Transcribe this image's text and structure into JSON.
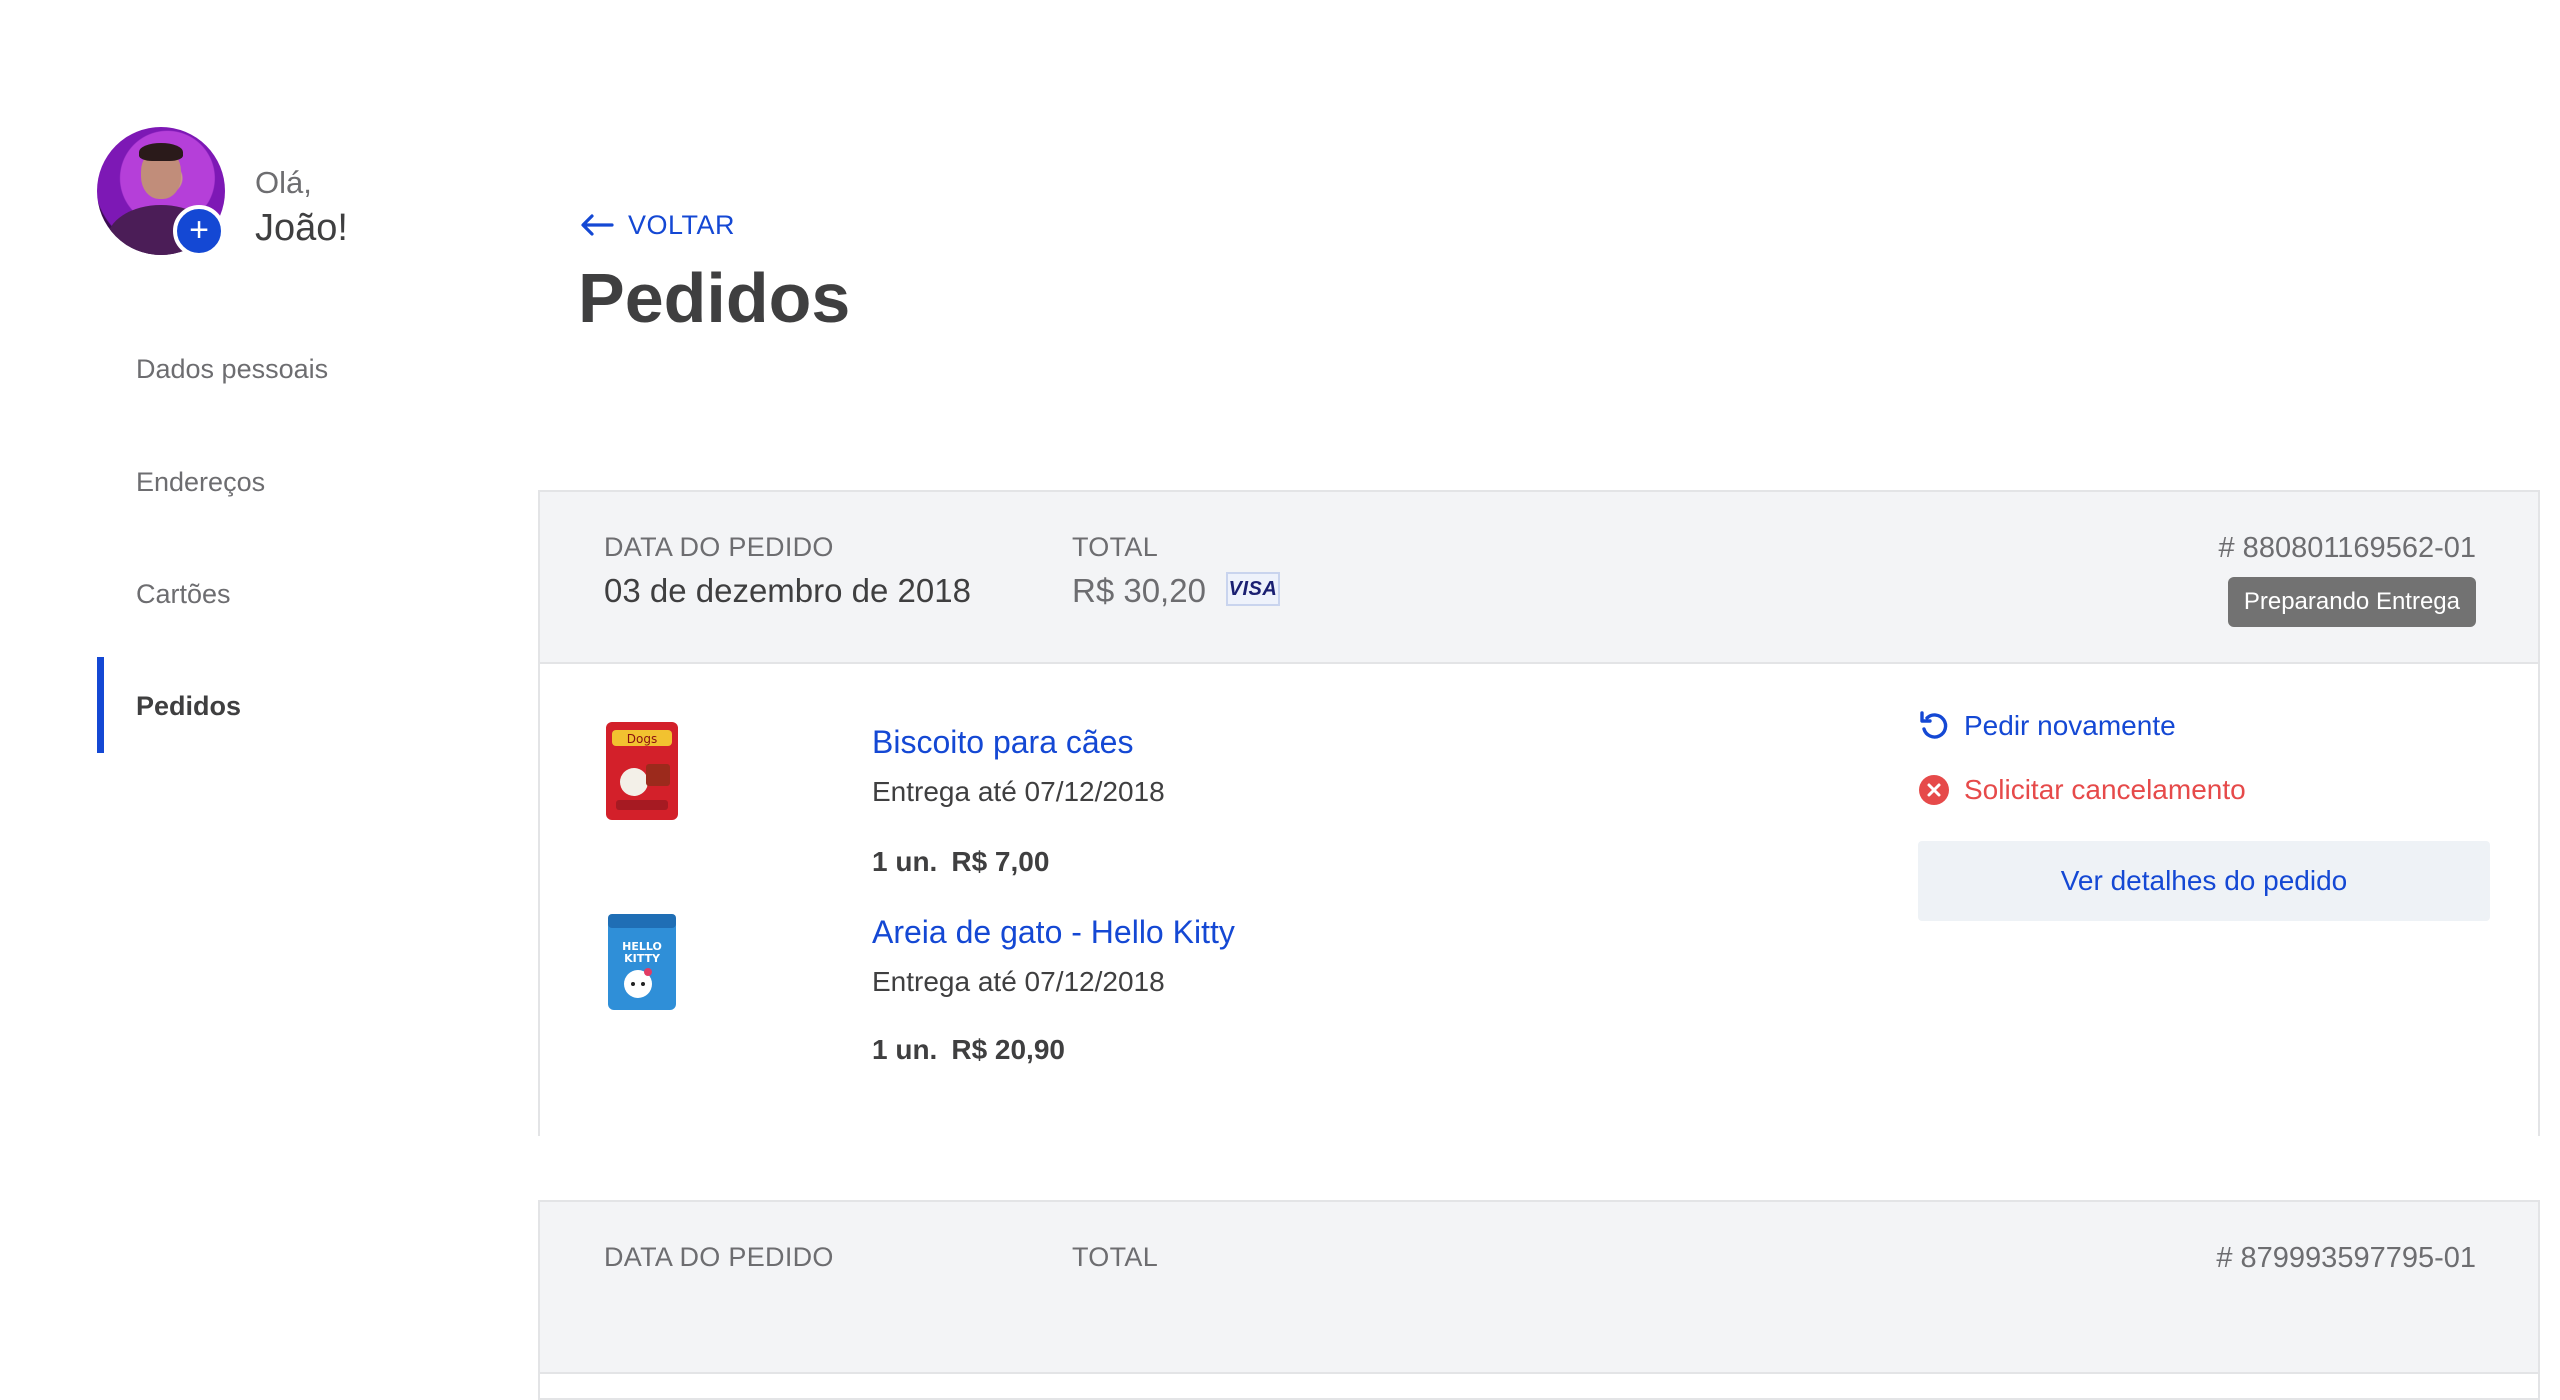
{
  "profile": {
    "greeting": "Olá,",
    "name": "João!",
    "add_photo_symbol": "+"
  },
  "sidebar": {
    "items": [
      {
        "label": "Dados pessoais",
        "active": false
      },
      {
        "label": "Endereços",
        "active": false
      },
      {
        "label": "Cartões",
        "active": false
      },
      {
        "label": "Pedidos",
        "active": true
      }
    ]
  },
  "header": {
    "back_label": "VOLTAR",
    "title": "Pedidos"
  },
  "orders": [
    {
      "date_label": "DATA DO PEDIDO",
      "date": "03 de dezembro de 2018",
      "total_label": "TOTAL",
      "total": "R$ 30,20",
      "card_brand": "VISA",
      "order_number": "# 880801169562-01",
      "status": "Preparando Entrega",
      "items": [
        {
          "name": "Biscoito para cães",
          "delivery": "Entrega até 07/12/2018",
          "quantity": "1 un.",
          "price": "R$ 7,00"
        },
        {
          "name": "Areia de gato - Hello Kitty",
          "delivery": "Entrega até 07/12/2018",
          "quantity": "1 un.",
          "price": "R$ 20,90"
        }
      ],
      "actions": {
        "reorder": "Pedir novamente",
        "cancel": "Solicitar cancelamento",
        "details": "Ver detalhes do pedido"
      }
    },
    {
      "date_label": "DATA DO PEDIDO",
      "total_label": "TOTAL",
      "order_number": "# 879993597795-01"
    }
  ],
  "colors": {
    "accent": "#1448d4",
    "danger": "#e64a4a",
    "header_bg": "#f3f4f6",
    "badge": "#727272"
  },
  "icons": [
    "arrow-left-icon",
    "reorder-icon",
    "cancel-icon",
    "plus-icon",
    "visa-icon"
  ]
}
